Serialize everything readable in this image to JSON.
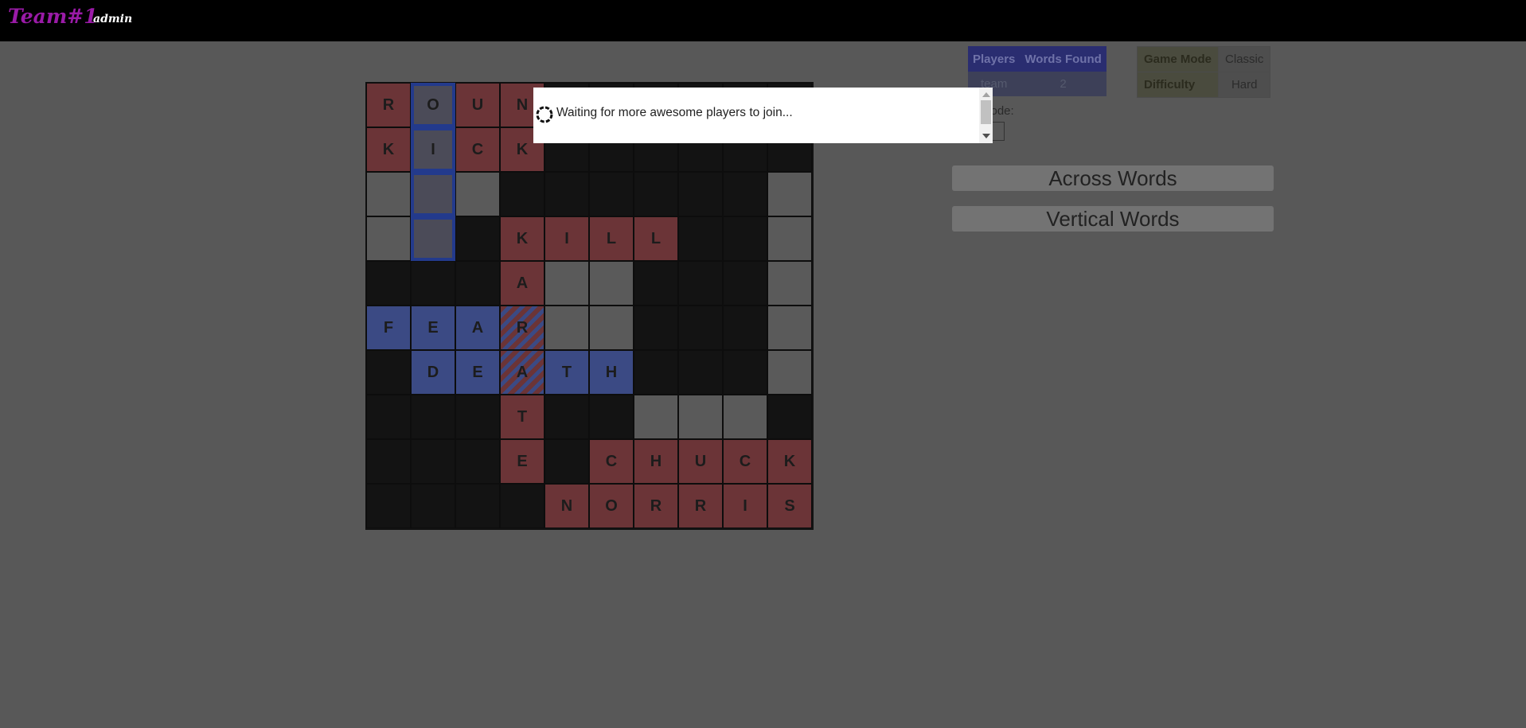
{
  "header": {
    "brand": "Team#1",
    "user": "admin"
  },
  "board": {
    "rows": [
      [
        "R",
        "O",
        "U",
        "N",
        "",
        "",
        "",
        "",
        "",
        ""
      ],
      [
        "K",
        "I",
        "C",
        "K",
        "",
        "",
        "",
        "",
        "",
        ""
      ],
      [
        "",
        "",
        "",
        "",
        "",
        "",
        "",
        "",
        "",
        ""
      ],
      [
        "",
        "",
        "",
        "K",
        "I",
        "L",
        "L",
        "",
        "",
        ""
      ],
      [
        "",
        "",
        "",
        "A",
        "",
        "",
        "",
        "",
        "",
        ""
      ],
      [
        "F",
        "E",
        "A",
        "R",
        "",
        "",
        "",
        "",
        "",
        ""
      ],
      [
        "",
        "D",
        "E",
        "A",
        "T",
        "H",
        "",
        "",
        "",
        ""
      ],
      [
        "",
        "",
        "",
        "T",
        "",
        "",
        "",
        "",
        "",
        ""
      ],
      [
        "",
        "",
        "",
        "E",
        "",
        "C",
        "H",
        "U",
        "C",
        "K"
      ],
      [
        "",
        "",
        "",
        "",
        "N",
        "O",
        "R",
        "R",
        "I",
        "S"
      ]
    ],
    "types": [
      [
        "r",
        "sel",
        "r",
        "r",
        "b",
        "b",
        "b",
        "b",
        "b",
        "b"
      ],
      [
        "r",
        "sel",
        "r",
        "r",
        "b",
        "b",
        "b",
        "b",
        "b",
        "b"
      ],
      [
        "w",
        "sel",
        "w",
        "b",
        "b",
        "b",
        "b",
        "b",
        "b",
        "w"
      ],
      [
        "w",
        "sel",
        "b",
        "r",
        "r",
        "r",
        "r",
        "b",
        "b",
        "w"
      ],
      [
        "b",
        "b",
        "b",
        "r",
        "w",
        "w",
        "b",
        "b",
        "b",
        "w"
      ],
      [
        "u",
        "u",
        "u",
        "s",
        "w",
        "w",
        "b",
        "b",
        "b",
        "w"
      ],
      [
        "b",
        "u",
        "u",
        "s",
        "u",
        "u",
        "b",
        "b",
        "b",
        "w"
      ],
      [
        "b",
        "b",
        "b",
        "r",
        "b",
        "b",
        "w",
        "w",
        "w",
        "b"
      ],
      [
        "b",
        "b",
        "b",
        "r",
        "b",
        "r",
        "r",
        "r",
        "r",
        "r"
      ],
      [
        "b",
        "b",
        "b",
        "b",
        "r",
        "r",
        "r",
        "r",
        "r",
        "r"
      ]
    ]
  },
  "players_table": {
    "headers": [
      "Players",
      "Words Found"
    ],
    "rows": [
      [
        "team",
        "2"
      ]
    ]
  },
  "mode_table": [
    {
      "key": "Game Mode",
      "value": "Classic"
    },
    {
      "key": "Difficulty",
      "value": "Hard"
    }
  ],
  "mode_label": "mode:",
  "panels": {
    "across": "Across Words",
    "vertical": "Vertical Words"
  },
  "modal": {
    "message": "Waiting for more awesome players to join..."
  }
}
